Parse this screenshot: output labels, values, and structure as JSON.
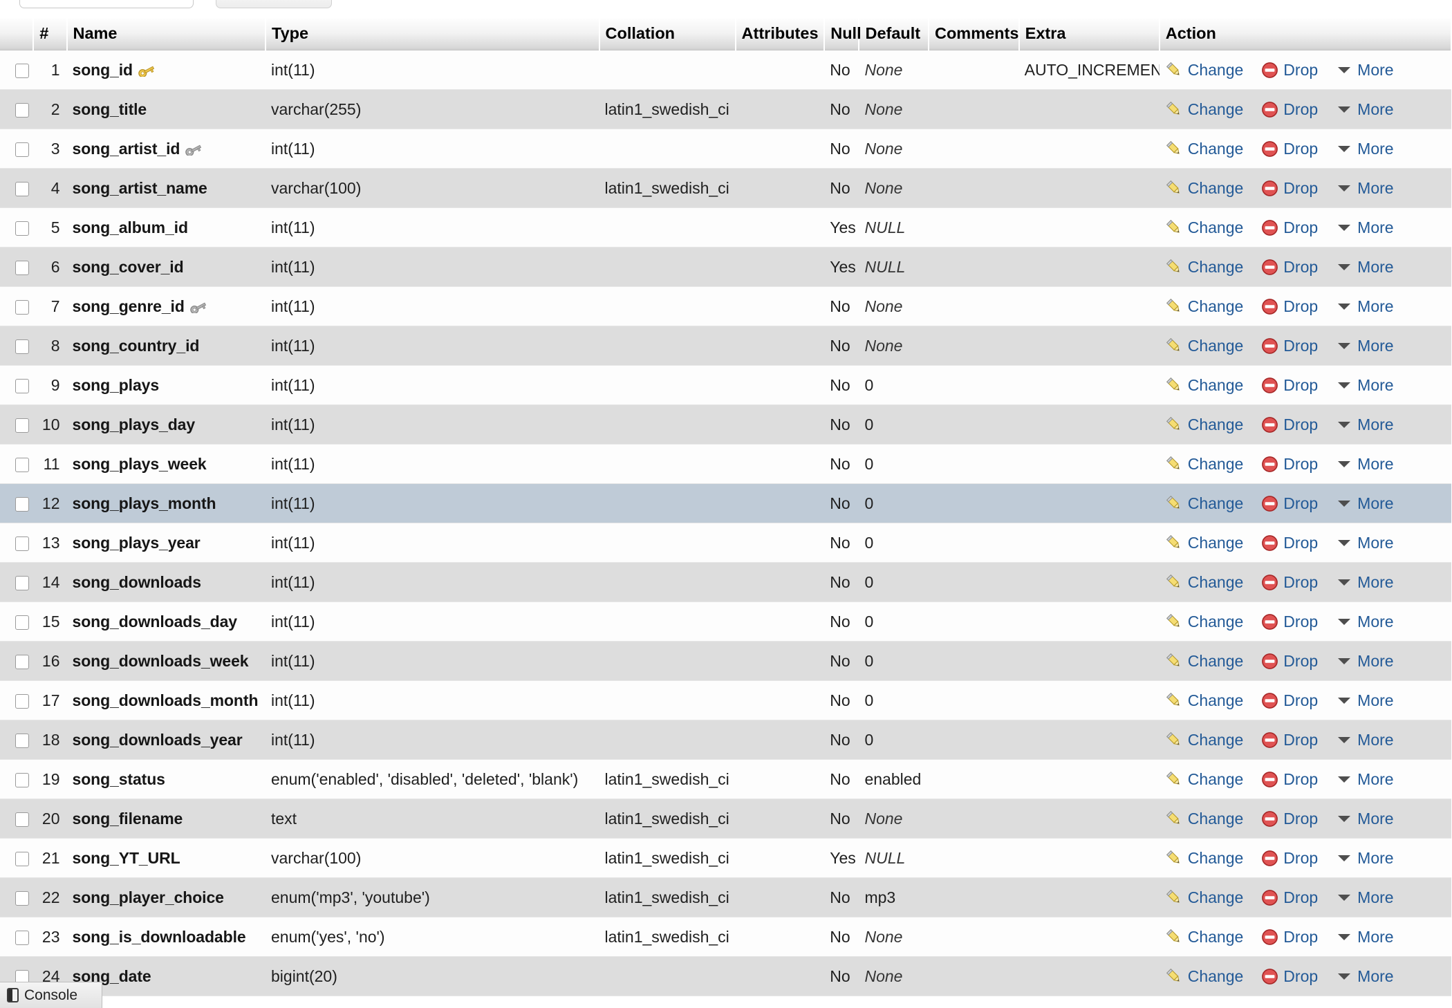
{
  "top_controls": {
    "search_input_value": "",
    "action_button_label": ""
  },
  "table": {
    "headers": {
      "checkbox": "",
      "number": "#",
      "name": "Name",
      "type": "Type",
      "collation": "Collation",
      "attributes": "Attributes",
      "null": "Null",
      "default": "Default",
      "comments": "Comments",
      "extra": "Extra",
      "action": "Action"
    },
    "action_labels": {
      "change": "Change",
      "drop": "Drop",
      "more": "More"
    },
    "rows": [
      {
        "num": "1",
        "name": "song_id",
        "key": "primary",
        "type": "int(11)",
        "collation": "",
        "attributes": "",
        "null": "No",
        "default": "None",
        "default_italic": true,
        "comments": "",
        "extra": "AUTO_INCREMENT",
        "stripe": "odd",
        "marked": false
      },
      {
        "num": "2",
        "name": "song_title",
        "key": "none",
        "type": "varchar(255)",
        "collation": "latin1_swedish_ci",
        "attributes": "",
        "null": "No",
        "default": "None",
        "default_italic": true,
        "comments": "",
        "extra": "",
        "stripe": "even",
        "marked": false
      },
      {
        "num": "3",
        "name": "song_artist_id",
        "key": "index",
        "type": "int(11)",
        "collation": "",
        "attributes": "",
        "null": "No",
        "default": "None",
        "default_italic": true,
        "comments": "",
        "extra": "",
        "stripe": "odd",
        "marked": false
      },
      {
        "num": "4",
        "name": "song_artist_name",
        "key": "none",
        "type": "varchar(100)",
        "collation": "latin1_swedish_ci",
        "attributes": "",
        "null": "No",
        "default": "None",
        "default_italic": true,
        "comments": "",
        "extra": "",
        "stripe": "even",
        "marked": false
      },
      {
        "num": "5",
        "name": "song_album_id",
        "key": "none",
        "type": "int(11)",
        "collation": "",
        "attributes": "",
        "null": "Yes",
        "default": "NULL",
        "default_italic": true,
        "comments": "",
        "extra": "",
        "stripe": "odd",
        "marked": false
      },
      {
        "num": "6",
        "name": "song_cover_id",
        "key": "none",
        "type": "int(11)",
        "collation": "",
        "attributes": "",
        "null": "Yes",
        "default": "NULL",
        "default_italic": true,
        "comments": "",
        "extra": "",
        "stripe": "even",
        "marked": false
      },
      {
        "num": "7",
        "name": "song_genre_id",
        "key": "index",
        "type": "int(11)",
        "collation": "",
        "attributes": "",
        "null": "No",
        "default": "None",
        "default_italic": true,
        "comments": "",
        "extra": "",
        "stripe": "odd",
        "marked": false
      },
      {
        "num": "8",
        "name": "song_country_id",
        "key": "none",
        "type": "int(11)",
        "collation": "",
        "attributes": "",
        "null": "No",
        "default": "None",
        "default_italic": true,
        "comments": "",
        "extra": "",
        "stripe": "even",
        "marked": false
      },
      {
        "num": "9",
        "name": "song_plays",
        "key": "none",
        "type": "int(11)",
        "collation": "",
        "attributes": "",
        "null": "No",
        "default": "0",
        "default_italic": false,
        "comments": "",
        "extra": "",
        "stripe": "odd",
        "marked": false
      },
      {
        "num": "10",
        "name": "song_plays_day",
        "key": "none",
        "type": "int(11)",
        "collation": "",
        "attributes": "",
        "null": "No",
        "default": "0",
        "default_italic": false,
        "comments": "",
        "extra": "",
        "stripe": "even",
        "marked": false
      },
      {
        "num": "11",
        "name": "song_plays_week",
        "key": "none",
        "type": "int(11)",
        "collation": "",
        "attributes": "",
        "null": "No",
        "default": "0",
        "default_italic": false,
        "comments": "",
        "extra": "",
        "stripe": "odd",
        "marked": false
      },
      {
        "num": "12",
        "name": "song_plays_month",
        "key": "none",
        "type": "int(11)",
        "collation": "",
        "attributes": "",
        "null": "No",
        "default": "0",
        "default_italic": false,
        "comments": "",
        "extra": "",
        "stripe": "even",
        "marked": true
      },
      {
        "num": "13",
        "name": "song_plays_year",
        "key": "none",
        "type": "int(11)",
        "collation": "",
        "attributes": "",
        "null": "No",
        "default": "0",
        "default_italic": false,
        "comments": "",
        "extra": "",
        "stripe": "odd",
        "marked": false
      },
      {
        "num": "14",
        "name": "song_downloads",
        "key": "none",
        "type": "int(11)",
        "collation": "",
        "attributes": "",
        "null": "No",
        "default": "0",
        "default_italic": false,
        "comments": "",
        "extra": "",
        "stripe": "even",
        "marked": false
      },
      {
        "num": "15",
        "name": "song_downloads_day",
        "key": "none",
        "type": "int(11)",
        "collation": "",
        "attributes": "",
        "null": "No",
        "default": "0",
        "default_italic": false,
        "comments": "",
        "extra": "",
        "stripe": "odd",
        "marked": false
      },
      {
        "num": "16",
        "name": "song_downloads_week",
        "key": "none",
        "type": "int(11)",
        "collation": "",
        "attributes": "",
        "null": "No",
        "default": "0",
        "default_italic": false,
        "comments": "",
        "extra": "",
        "stripe": "even",
        "marked": false
      },
      {
        "num": "17",
        "name": "song_downloads_month",
        "key": "none",
        "type": "int(11)",
        "collation": "",
        "attributes": "",
        "null": "No",
        "default": "0",
        "default_italic": false,
        "comments": "",
        "extra": "",
        "stripe": "odd",
        "marked": false
      },
      {
        "num": "18",
        "name": "song_downloads_year",
        "key": "none",
        "type": "int(11)",
        "collation": "",
        "attributes": "",
        "null": "No",
        "default": "0",
        "default_italic": false,
        "comments": "",
        "extra": "",
        "stripe": "even",
        "marked": false
      },
      {
        "num": "19",
        "name": "song_status",
        "key": "none",
        "type": "enum('enabled', 'disabled', 'deleted', 'blank')",
        "collation": "latin1_swedish_ci",
        "attributes": "",
        "null": "No",
        "default": "enabled",
        "default_italic": false,
        "comments": "",
        "extra": "",
        "stripe": "odd",
        "marked": false
      },
      {
        "num": "20",
        "name": "song_filename",
        "key": "none",
        "type": "text",
        "collation": "latin1_swedish_ci",
        "attributes": "",
        "null": "No",
        "default": "None",
        "default_italic": true,
        "comments": "",
        "extra": "",
        "stripe": "even",
        "marked": false
      },
      {
        "num": "21",
        "name": "song_YT_URL",
        "key": "none",
        "type": "varchar(100)",
        "collation": "latin1_swedish_ci",
        "attributes": "",
        "null": "Yes",
        "default": "NULL",
        "default_italic": true,
        "comments": "",
        "extra": "",
        "stripe": "odd",
        "marked": false
      },
      {
        "num": "22",
        "name": "song_player_choice",
        "key": "none",
        "type": "enum('mp3', 'youtube')",
        "collation": "latin1_swedish_ci",
        "attributes": "",
        "null": "No",
        "default": "mp3",
        "default_italic": false,
        "comments": "",
        "extra": "",
        "stripe": "even",
        "marked": false
      },
      {
        "num": "23",
        "name": "song_is_downloadable",
        "key": "none",
        "type": "enum('yes', 'no')",
        "collation": "latin1_swedish_ci",
        "attributes": "",
        "null": "No",
        "default": "None",
        "default_italic": true,
        "comments": "",
        "extra": "",
        "stripe": "odd",
        "marked": false
      },
      {
        "num": "24",
        "name": "song_date",
        "key": "none",
        "type": "bigint(20)",
        "collation": "",
        "attributes": "",
        "null": "No",
        "default": "None",
        "default_italic": true,
        "comments": "",
        "extra": "",
        "stripe": "even",
        "marked": false
      }
    ]
  },
  "console": {
    "label": "Console"
  },
  "colors": {
    "link": "#235a97",
    "marked_row": "#bfcbd7",
    "even_row": "#dddddd",
    "odd_row": "#fdfdfd",
    "drop_icon": "#d64040",
    "primary_key": "#e8c44a",
    "index_key": "#a9a9a9"
  }
}
